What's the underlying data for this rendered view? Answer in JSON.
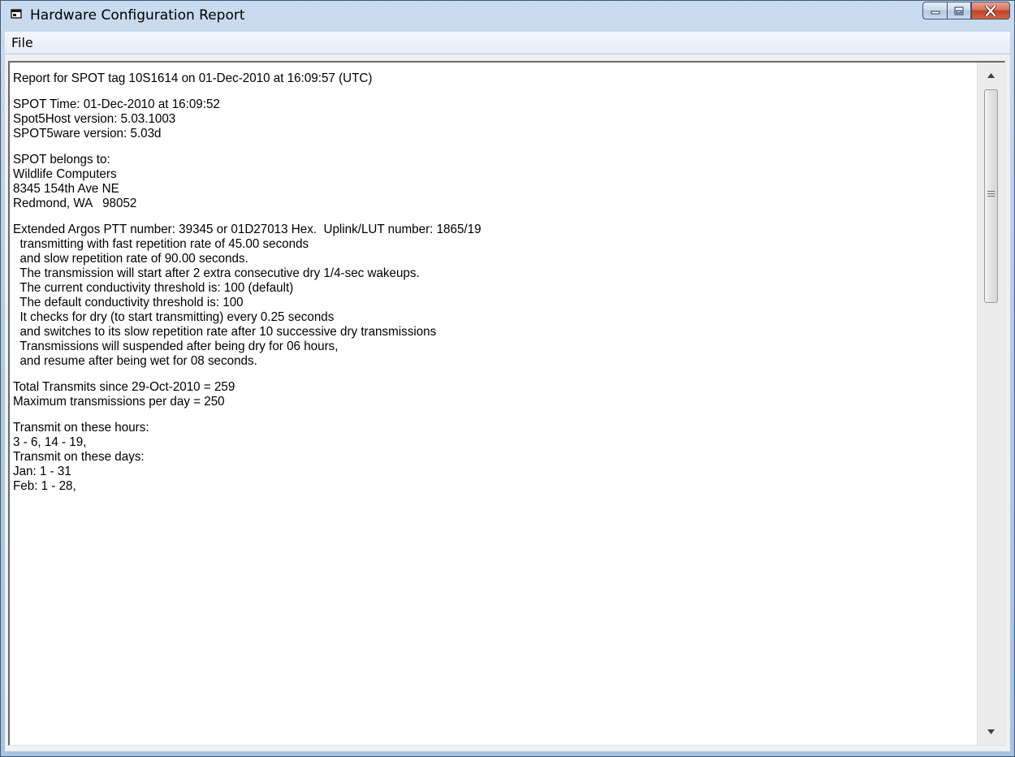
{
  "window": {
    "title": "Hardware Configuration Report",
    "icon": "app-window-icon",
    "caption_buttons": [
      "minimize-icon",
      "maximize-icon",
      "close-icon"
    ],
    "close_color": "#c1442a"
  },
  "menubar": {
    "file_label": "File"
  },
  "report": {
    "blocks": [
      [
        "Report for SPOT tag 10S1614 on 01-Dec-2010 at 16:09:57 (UTC)"
      ],
      [
        "SPOT Time: 01-Dec-2010 at 16:09:52",
        "Spot5Host version: 5.03.1003",
        "SPOT5ware version: 5.03d"
      ],
      [
        "SPOT belongs to:",
        "Wildlife Computers",
        "8345 154th Ave NE",
        "Redmond, WA   98052"
      ],
      [
        "Extended Argos PTT number: 39345 or 01D27013 Hex.  Uplink/LUT number: 1865/19",
        "  transmitting with fast repetition rate of 45.00 seconds",
        "  and slow repetition rate of 90.00 seconds.",
        "  The transmission will start after 2 extra consecutive dry 1/4-sec wakeups.",
        "  The current conductivity threshold is: 100 (default)",
        "  The default conductivity threshold is: 100",
        "  It checks for dry (to start transmitting) every 0.25 seconds",
        "  and switches to its slow repetition rate after 10 successive dry transmissions",
        "  Transmissions will suspended after being dry for 06 hours,",
        "  and resume after being wet for 08 seconds."
      ],
      [
        "Total Transmits since 29-Oct-2010 = 259",
        "Maximum transmissions per day = 250"
      ],
      [
        "Transmit on these hours:",
        "3 - 6, 14 - 19,",
        "Transmit on these days:",
        "Jan: 1 - 31",
        "Feb: 1 - 28,"
      ]
    ]
  },
  "scrollbar": {
    "up_icon": "scroll-up-arrow-icon",
    "down_icon": "scroll-down-arrow-icon",
    "grip_icon": "scroll-thumb-grip-icon"
  }
}
